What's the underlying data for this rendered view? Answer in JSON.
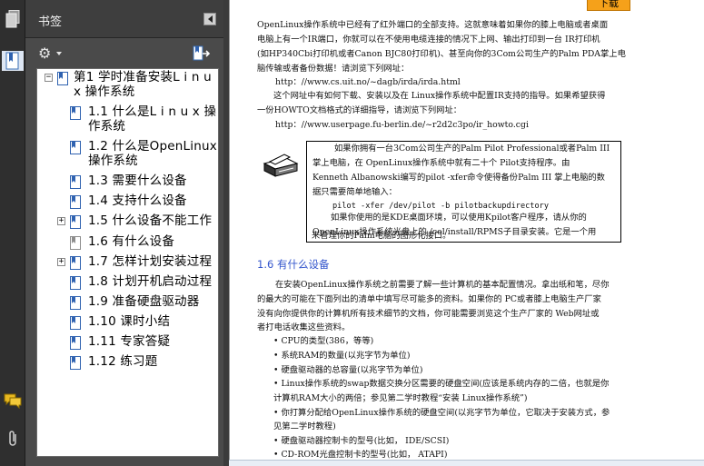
{
  "panel": {
    "title": "书签"
  },
  "icons": {
    "pages": "pages-icon",
    "bookmarks": "bookmark-icon",
    "comments": "comments-icon",
    "attachments": "paperclip-icon",
    "options": "gear-icon",
    "export": "bookmark-export-icon"
  },
  "tree": [
    {
      "label1": "第1 学时准备安装L i n u",
      "label2": "x 操作系统",
      "expander": "−",
      "bm": "blue"
    },
    {
      "label1": "1.1 什么是L i n u x 操",
      "label2": "作系统",
      "expander": "",
      "bm": "blue"
    },
    {
      "label1": "1.2 什么是OpenLinux",
      "label2": "操作系统",
      "expander": "",
      "bm": "blue"
    },
    {
      "label1": "1.3 需要什么设备",
      "label2": "",
      "expander": "",
      "bm": "blue"
    },
    {
      "label1": "1.4 支持什么设备",
      "label2": "",
      "expander": "",
      "bm": "blue"
    },
    {
      "label1": "1.5 什么设备不能工作",
      "label2": "",
      "expander": "+",
      "bm": "blue"
    },
    {
      "label1": "1.6 有什么设备",
      "label2": "",
      "expander": "",
      "bm": "gray"
    },
    {
      "label1": "1.7 怎样计划安装过程",
      "label2": "",
      "expander": "+",
      "bm": "blue"
    },
    {
      "label1": "1.8 计划开机启动过程",
      "label2": "",
      "expander": "",
      "bm": "blue"
    },
    {
      "label1": "1.9 准备硬盘驱动器",
      "label2": "",
      "expander": "",
      "bm": "blue"
    },
    {
      "label1": "1.10 课时小结",
      "label2": "",
      "expander": "",
      "bm": "blue"
    },
    {
      "label1": "1.11 专家答疑",
      "label2": "",
      "expander": "",
      "bm": "blue"
    },
    {
      "label1": "1.12 练习题",
      "label2": "",
      "expander": "",
      "bm": "blue"
    }
  ],
  "doc": {
    "download_button": "下载",
    "lines": [
      "OpenLinux操作系统中已经有了红外端口的全部支持。这就意味着如果你的膝上电脑或者桌面",
      "电脑上有一个IR端口，你就可以在不使用电缆连接的情况下上网、输出打印到一台  IR打印机",
      "(如HP340Cbi打印机或者Canon BJC80打印机)、甚至向你的3Com公司生产的Palm PDA掌上电",
      "脑传输或者备份数据！请浏览下列网址：",
      "http：//www.cs.uit.no/~dagb/irda/irda.html",
      "这个网址中有如何下载、安装以及在 Linux操作系统中配置IR支持的指导。如果希望获得",
      "一份HOWTO文档格式的详细指导，请浏览下列网址：",
      "http：//www.userpage.fu-berlin.de/~r2d2c3po/ir_howto.cgi"
    ],
    "box_lines": [
      "如果你拥有一台3Com公司生产的Palm Pilot Professional或者Palm III",
      "掌上电脑，在 OpenLinux操作系统中就有二十个  Pilot支持程序。由",
      "Kenneth Albanowski编写的pilot -xfer命令使得备份Palm III 掌上电脑的数",
      "据只需要简单地输入：",
      "pilot -xfer /dev/pilot -b pilotbackupdirectory",
      "如果你使用的是KDE桌面环境，可以使用Kpilot客户程序，请从你的",
      "OpenLinux操作系统光盘上的 /col/install/RPMS子目录安装。它是一个用",
      "来管理你的Palm电脑的图形化接口。"
    ],
    "section_title": "1.6   有什么设备",
    "section_lines": [
      "在安装OpenLinux操作系统之前需要了解一些计算机的基本配置情况。拿出纸和笔，尽你",
      "的最大的可能在下面列出的清单中填写尽可能多的资料。如果你的  PC或者膝上电脑生产厂家",
      "没有向你提供你的计算机所有技术细节的文档，你可能需要浏览这个生产厂家的   Web网址或",
      "者打电话收集这些资料。"
    ],
    "bullets": [
      "• CPU的类型(386，等等)",
      "• 系统RAM的数量(以兆字节为单位)",
      "• 硬盘驱动器的总容量(以兆字节为单位)",
      "• Linux操作系统的swap数据交换分区需要的硬盘空间(应该是系统内存的二倍，也就是你",
      "  计算机RAM大小的两倍；参见第二学时教程“安装 Linux操作系统”)",
      "• 你打算分配给OpenLinux操作系统的硬盘空间(以兆字节为单位，它取决于安装方式，参",
      "  见第二学时教程)",
      "• 硬盘驱动器控制卡的型号(比如， IDE/SCSI)",
      "• CD-ROM光盘控制卡的型号(比如， ATAPI)"
    ]
  }
}
